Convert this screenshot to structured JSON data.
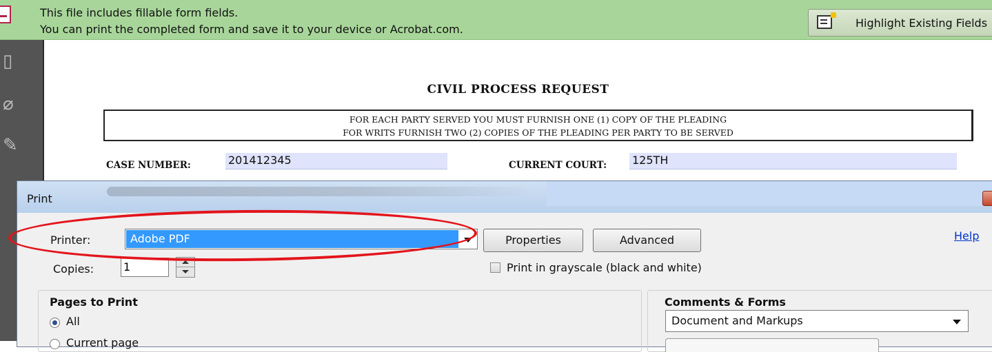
{
  "notification": {
    "line1": "This file includes fillable form fields.",
    "line2": "You can print the completed form and save it to your device or Acrobat.com.",
    "highlight_button": "Highlight Existing Fields"
  },
  "document": {
    "title": "CIVIL PROCESS REQUEST",
    "notice_line1": "FOR EACH PARTY SERVED YOU MUST FURNISH ONE (1) COPY OF THE PLEADING",
    "notice_line2": "FOR WRITS FURNISH TWO (2) COPIES OF THE PLEADING PER PARTY TO BE SERVED",
    "case_number_label": "CASE NUMBER:",
    "case_number_value": "201412345",
    "current_court_label": "CURRENT COURT:",
    "current_court_value": "125TH"
  },
  "print_dialog": {
    "title": "Print",
    "printer_label": "Printer:",
    "printer_value": "Adobe PDF",
    "properties_button": "Properties",
    "advanced_button": "Advanced",
    "help_link": "Help",
    "copies_label": "Copies:",
    "copies_value": "1",
    "grayscale_label": "Print in grayscale (black and white)",
    "pages_group_title": "Pages to Print",
    "pages_options": [
      "All",
      "Current page"
    ],
    "pages_selected": "All",
    "comments_group_title": "Comments & Forms",
    "comments_value": "Document and Markups"
  },
  "colors": {
    "notification_bg": "#a8d69a",
    "selection_blue": "#3399ff",
    "annotation_red": "#e3141b",
    "form_field_bg": "#dfe3fb"
  }
}
